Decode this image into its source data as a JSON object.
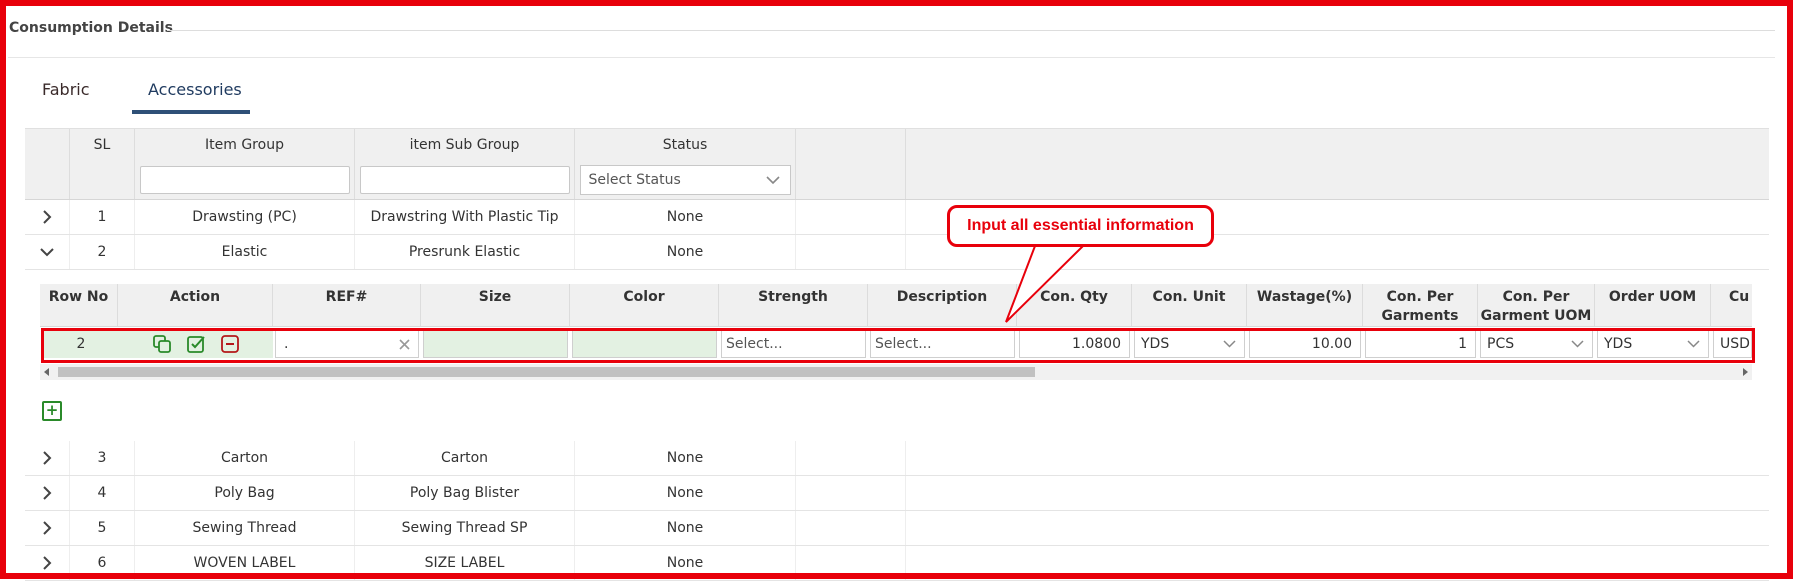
{
  "section": {
    "title": "Consumption Details"
  },
  "tabs": [
    {
      "label": "Fabric"
    },
    {
      "label": "Accessories"
    }
  ],
  "grid": {
    "headers": {
      "sl": "SL",
      "item_group": "Item Group",
      "item_sub_group": "item Sub Group",
      "status": "Status"
    },
    "filter": {
      "status_placeholder": "Select Status"
    },
    "rows": [
      {
        "sl": "1",
        "item_group": "Drawsting (PC)",
        "item_sub_group": "Drawstring With Plastic Tip",
        "status": "None"
      },
      {
        "sl": "2",
        "item_group": "Elastic",
        "item_sub_group": "Presrunk Elastic",
        "status": "None"
      },
      {
        "sl": "3",
        "item_group": "Carton",
        "item_sub_group": "Carton",
        "status": "None"
      },
      {
        "sl": "4",
        "item_group": "Poly Bag",
        "item_sub_group": "Poly Bag Blister",
        "status": "None"
      },
      {
        "sl": "5",
        "item_group": "Sewing Thread",
        "item_sub_group": "Sewing Thread SP",
        "status": "None"
      },
      {
        "sl": "6",
        "item_group": "WOVEN LABEL",
        "item_sub_group": "SIZE LABEL",
        "status": "None"
      }
    ]
  },
  "detail": {
    "headers": {
      "row_no": "Row No",
      "action": "Action",
      "ref": "REF#",
      "size": "Size",
      "color": "Color",
      "strength": "Strength",
      "description": "Description",
      "con_qty": "Con. Qty",
      "con_unit": "Con. Unit",
      "wastage": "Wastage(%)",
      "con_per_garments_1": "Con. Per",
      "con_per_garments_2": "Garments",
      "con_per_garment_uom_1": "Con. Per",
      "con_per_garment_uom_2": "Garment UOM",
      "order_uom": "Order UOM",
      "currency": "Cu"
    },
    "row": {
      "row_no": "2",
      "ref": ".",
      "strength": "Select...",
      "description": "Select...",
      "con_qty": "1.0800",
      "con_unit": "YDS",
      "wastage": "10.00",
      "con_per_garments": "1",
      "con_per_garment_uom": "PCS",
      "order_uom": "YDS",
      "currency": "USD"
    }
  },
  "callout": {
    "text": "Input all essential information"
  },
  "colors": {
    "highlight": "#e8000b",
    "accent": "#2e5077",
    "action_green": "#2a8a2a",
    "action_red": "#b5171a"
  }
}
